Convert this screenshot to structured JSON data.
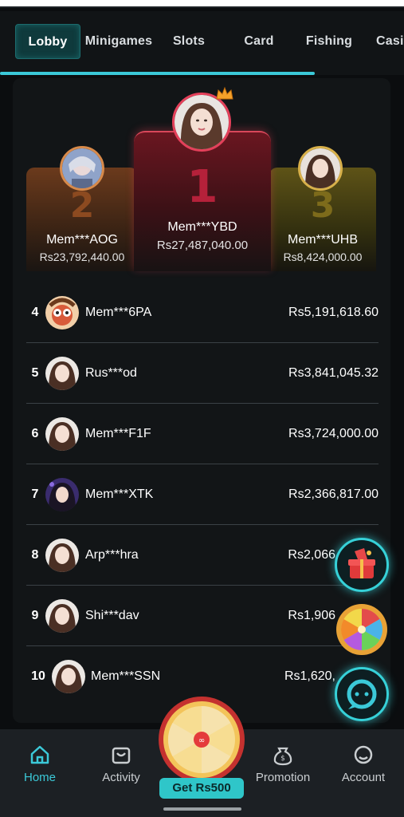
{
  "tabs": [
    {
      "label": "Lobby",
      "active": true
    },
    {
      "label": "Minigames"
    },
    {
      "label": "Slots"
    },
    {
      "label": "Card"
    },
    {
      "label": "Fishing"
    },
    {
      "label": "Casi"
    }
  ],
  "tab_scroll_progress": 0.78,
  "podium": {
    "first": {
      "rank": "1",
      "name": "Mem***YBD",
      "amount": "Rs27,487,040.00"
    },
    "second": {
      "rank": "2",
      "name": "Mem***AOG",
      "amount": "Rs23,792,440.00"
    },
    "third": {
      "rank": "3",
      "name": "Mem***UHB",
      "amount": "Rs8,424,000.00"
    }
  },
  "leaderboard": [
    {
      "rank": "4",
      "name": "Mem***6PA",
      "amount": "Rs5,191,618.60"
    },
    {
      "rank": "5",
      "name": "Rus***od",
      "amount": "Rs3,841,045.32"
    },
    {
      "rank": "6",
      "name": "Mem***F1F",
      "amount": "Rs3,724,000.00"
    },
    {
      "rank": "7",
      "name": "Mem***XTK",
      "amount": "Rs2,366,817.00"
    },
    {
      "rank": "8",
      "name": "Arp***hra",
      "amount": "Rs2,066"
    },
    {
      "rank": "9",
      "name": "Shi***dav",
      "amount": "Rs1,906"
    },
    {
      "rank": "10",
      "name": "Mem***SSN",
      "amount": "Rs1,620,"
    }
  ],
  "bottom_nav": {
    "home": "Home",
    "activity": "Activity",
    "promotion": "Promotion",
    "account": "Account",
    "get_button": "Get Rs500"
  },
  "colors": {
    "accent": "#3bc9d8",
    "rank1": "#b5213a",
    "rank2": "#8c4a20",
    "rank3": "#7d6b1b"
  },
  "icons": [
    "crown-icon",
    "gift-icon",
    "lucky-wheel-icon",
    "chat-support-icon",
    "home-icon",
    "activity-icon",
    "promotion-icon",
    "account-icon"
  ]
}
